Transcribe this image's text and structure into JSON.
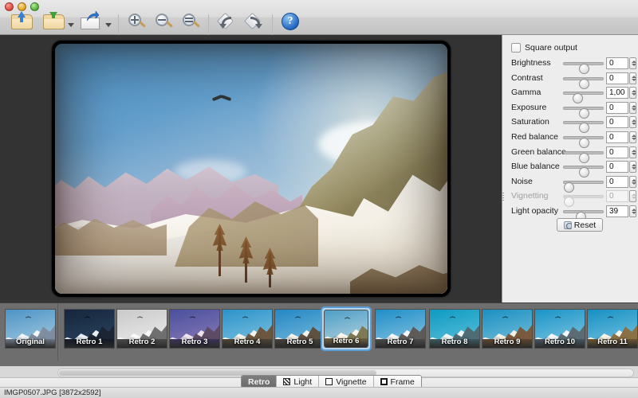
{
  "window": {
    "traffic_lights": [
      "close",
      "minimize",
      "zoom"
    ]
  },
  "toolbar": {
    "items": [
      {
        "name": "open-folder-button",
        "icon": "folder-up-icon",
        "label": ""
      },
      {
        "name": "save-folder-button",
        "icon": "folder-down-icon",
        "label": ""
      },
      {
        "name": "export-button",
        "icon": "export-arrow-icon",
        "label": ""
      },
      {
        "name": "zoom-in-button",
        "icon": "magnifier-plus-icon",
        "label": ""
      },
      {
        "name": "zoom-out-button",
        "icon": "magnifier-minus-icon",
        "label": ""
      },
      {
        "name": "zoom-fit-button",
        "icon": "magnifier-equals-icon",
        "label": ""
      },
      {
        "name": "rotate-left-button",
        "icon": "rotate-left-icon",
        "label": ""
      },
      {
        "name": "rotate-right-button",
        "icon": "rotate-right-icon",
        "label": ""
      },
      {
        "name": "help-button",
        "icon": "help-question-icon",
        "label": "?"
      }
    ]
  },
  "panel": {
    "square_output": {
      "label": "Square output",
      "checked": false
    },
    "controls": [
      {
        "label": "Brightness",
        "value": "0",
        "pos": 50,
        "enabled": true
      },
      {
        "label": "Contrast",
        "value": "0",
        "pos": 50,
        "enabled": true
      },
      {
        "label": "Gamma",
        "value": "1,00",
        "pos": 28,
        "enabled": true
      },
      {
        "label": "Exposure",
        "value": "0",
        "pos": 50,
        "enabled": true
      },
      {
        "label": "Saturation",
        "value": "0",
        "pos": 50,
        "enabled": true
      },
      {
        "label": "Red balance",
        "value": "0",
        "pos": 50,
        "enabled": true
      },
      {
        "label": "Green balance",
        "value": "0",
        "pos": 50,
        "enabled": true
      },
      {
        "label": "Blue balance",
        "value": "0",
        "pos": 50,
        "enabled": true
      },
      {
        "label": "Noise",
        "value": "0",
        "pos": 0,
        "enabled": true
      },
      {
        "label": "Vignetting",
        "value": "0",
        "pos": 0,
        "enabled": false
      },
      {
        "label": "Light opacity",
        "value": "39",
        "pos": 39,
        "enabled": true
      }
    ],
    "reset_label": "Reset"
  },
  "filmstrip": {
    "items": [
      {
        "label": "Original",
        "selected": false,
        "sky": "#4d93c6",
        "sky2": "#a9cfe2",
        "rock": "#7e8ea0",
        "snow": "#f2f6fa",
        "fore": "#6b7683"
      },
      {
        "label": "Retro 1",
        "selected": false,
        "sky": "#16263c",
        "sky2": "#2c4664",
        "rock": "#1b2533",
        "snow": "#e8eef4",
        "fore": "#121a25"
      },
      {
        "label": "Retro 2",
        "selected": false,
        "sky": "#c9c9c9",
        "sky2": "#efefef",
        "rock": "#6f6f6f",
        "snow": "#fbfbfb",
        "fore": "#4a4a4a"
      },
      {
        "label": "Retro 3",
        "selected": false,
        "sky": "#4a4f9e",
        "sky2": "#8f7fb8",
        "rock": "#5c4a66",
        "snow": "#efe4ee",
        "fore": "#3c3358"
      },
      {
        "label": "Retro 4",
        "selected": false,
        "sky": "#2b92c9",
        "sky2": "#86c7e2",
        "rock": "#6b5640",
        "snow": "#f6f3ea",
        "fore": "#4c4334"
      },
      {
        "label": "Retro 5",
        "selected": false,
        "sky": "#2487c4",
        "sky2": "#7dbedd",
        "rock": "#5f5140",
        "snow": "#f4f2ea",
        "fore": "#45403a"
      },
      {
        "label": "Retro 6",
        "selected": true,
        "sky": "#4d9ec6",
        "sky2": "#bfd8e0",
        "rock": "#7d7a55",
        "snow": "#fbf7ec",
        "fore": "#6e6242"
      },
      {
        "label": "Retro 7",
        "selected": false,
        "sky": "#1f8ec7",
        "sky2": "#8fc8e4",
        "rock": "#5d5a58",
        "snow": "#f7f8f9",
        "fore": "#4a4a4a"
      },
      {
        "label": "Retro 8",
        "selected": false,
        "sky": "#0e9ac2",
        "sky2": "#62c3dc",
        "rock": "#4e6a72",
        "snow": "#f1f7f8",
        "fore": "#3b5a60"
      },
      {
        "label": "Retro 9",
        "selected": false,
        "sky": "#1b8fc0",
        "sky2": "#7bc4de",
        "rock": "#7a5a3e",
        "snow": "#f7f2e8",
        "fore": "#5d4730"
      },
      {
        "label": "Retro 10",
        "selected": false,
        "sky": "#1a93c6",
        "sky2": "#86cbe5",
        "rock": "#5b6b74",
        "snow": "#f6fafc",
        "fore": "#455660"
      },
      {
        "label": "Retro 11",
        "selected": false,
        "sky": "#1590c3",
        "sky2": "#7fc6e2",
        "rock": "#8a7044",
        "snow": "#f9f4e6",
        "fore": "#6a5531"
      }
    ]
  },
  "tabs": {
    "items": [
      {
        "label": "Retro",
        "icon": "",
        "active": true
      },
      {
        "label": "Light",
        "icon": "light-icon",
        "active": false
      },
      {
        "label": "Vignette",
        "icon": "square-outline-icon",
        "active": false
      },
      {
        "label": "Frame",
        "icon": "square-thick-icon",
        "active": false
      }
    ]
  },
  "status": {
    "text": "IMGP0507.JPG [3872x2592]"
  },
  "scrollbar": {
    "orientation": "horizontal",
    "thumb_percent": 55
  }
}
